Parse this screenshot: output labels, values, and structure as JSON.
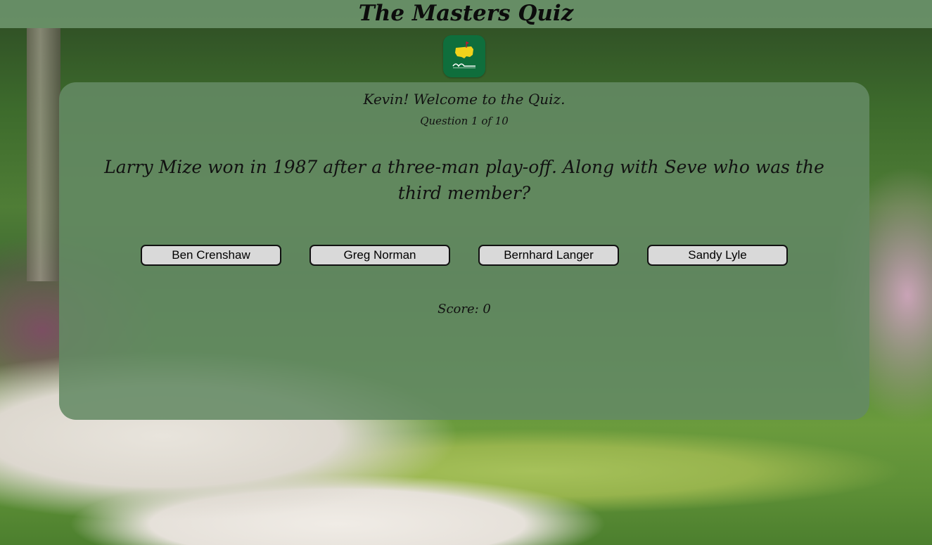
{
  "header": {
    "title": "The Masters Quiz"
  },
  "logo": {
    "icon": "masters-logo-icon",
    "text": "Masters",
    "brand_color": "#0f6e3c",
    "accent_color": "#f2d21b"
  },
  "quiz": {
    "welcome": "Kevin! Welcome to the Quiz.",
    "progress": "Question 1 of 10",
    "question": "Larry Mize won in 1987 after a three-man play-off. Along with Seve who was the third member?",
    "answers": [
      {
        "label": "Ben Crenshaw"
      },
      {
        "label": "Greg Norman"
      },
      {
        "label": "Bernhard Langer"
      },
      {
        "label": "Sandy Lyle"
      }
    ],
    "score": "Score: 0"
  }
}
